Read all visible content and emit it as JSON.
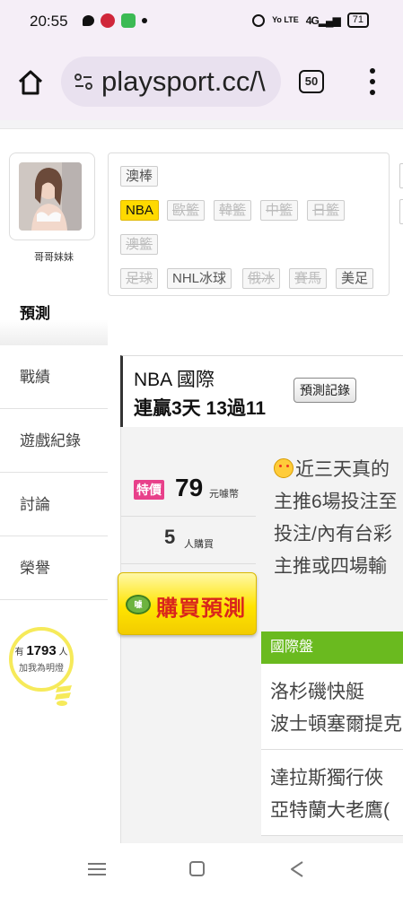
{
  "status_bar": {
    "time": "20:55",
    "volte": "Yo LTE",
    "signal": "4G",
    "battery": "71"
  },
  "browser": {
    "url": "playsport.cc/\\",
    "tab_count": "50"
  },
  "profile": {
    "name": "哥哥妹妹"
  },
  "side_nav": {
    "items": [
      {
        "label": "預測"
      },
      {
        "label": "戰績"
      },
      {
        "label": "遊戲紀錄"
      },
      {
        "label": "討論"
      },
      {
        "label": "榮譽"
      }
    ]
  },
  "fans": {
    "prefix": "有",
    "count": "1793",
    "suffix": "人",
    "caption": "加我為明燈"
  },
  "categories": [
    {
      "label": "澳棒",
      "state": "normal"
    },
    {
      "label": "NBA",
      "state": "active"
    },
    {
      "label": "歐籃",
      "state": "disabled"
    },
    {
      "label": "韓籃",
      "state": "disabled"
    },
    {
      "label": "中籃",
      "state": "disabled"
    },
    {
      "label": "日籃",
      "state": "disabled"
    },
    {
      "label": "澳籃",
      "state": "disabled"
    },
    {
      "label": "足球",
      "state": "disabled"
    },
    {
      "label": "NHL冰球",
      "state": "normal"
    },
    {
      "label": "俄冰",
      "state": "disabled"
    },
    {
      "label": "賽馬",
      "state": "disabled"
    },
    {
      "label": "美足",
      "state": "normal"
    }
  ],
  "record": {
    "title": "NBA 國際",
    "stat": "連贏3天 13過11",
    "button": "預測記錄"
  },
  "offer": {
    "badge": "特價",
    "price": "79",
    "price_unit": "元噱幣",
    "buyers": "5",
    "buyers_unit": "人購買",
    "buy_button": "購買預測",
    "coin_label": "噱"
  },
  "description": {
    "lines": [
      "近三天真的",
      "主推6場投注至",
      "投注/內有台彩",
      "主推或四場輸"
    ]
  },
  "league": {
    "name": "國際盤"
  },
  "games": [
    {
      "home": "洛杉磯快艇",
      "away": "波士頓塞爾提克"
    },
    {
      "home": "達拉斯獨行俠",
      "away": "亞特蘭大老鷹("
    }
  ]
}
